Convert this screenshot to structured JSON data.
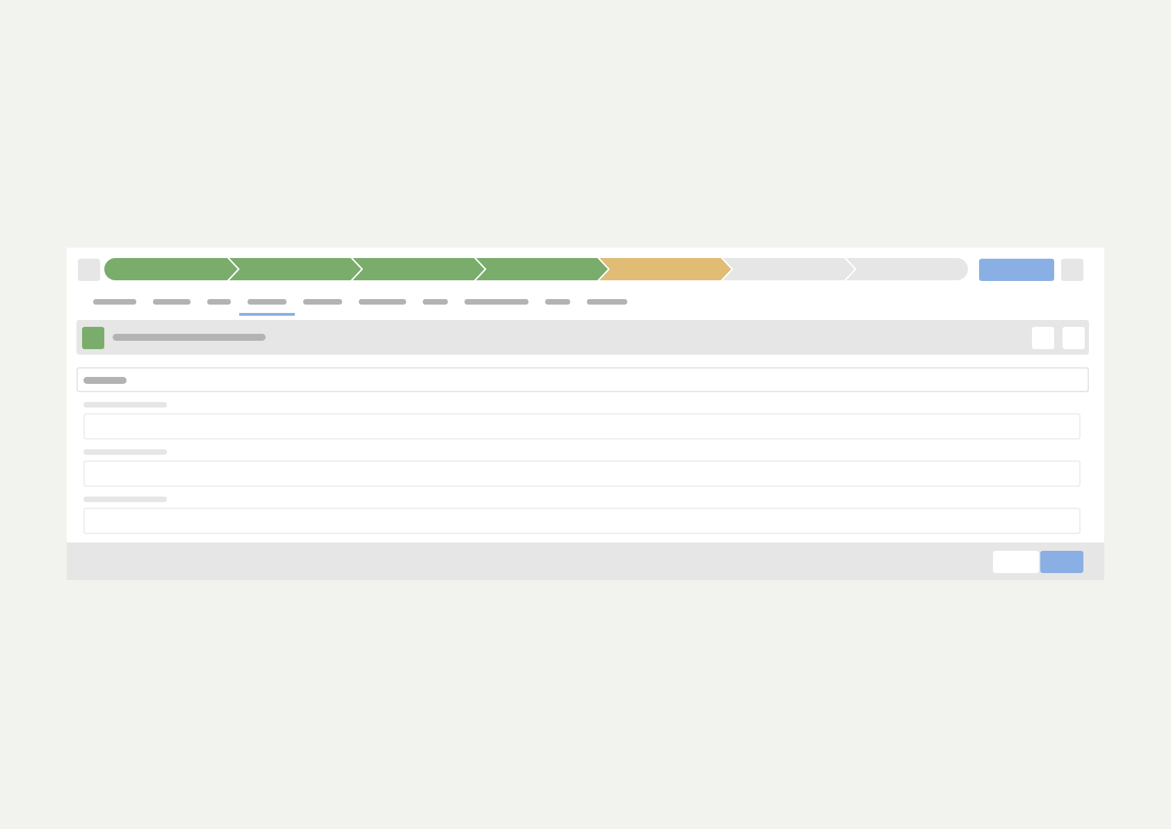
{
  "path": {
    "steps": [
      {
        "kind": "complete"
      },
      {
        "kind": "complete"
      },
      {
        "kind": "complete"
      },
      {
        "kind": "complete"
      },
      {
        "kind": "current"
      },
      {
        "kind": "pending"
      },
      {
        "kind": "pending"
      }
    ]
  },
  "tabs": [
    {
      "selected": false
    },
    {
      "selected": false
    },
    {
      "selected": false
    },
    {
      "selected": true
    },
    {
      "selected": false
    },
    {
      "selected": false
    },
    {
      "selected": false
    },
    {
      "selected": false
    },
    {
      "selected": false
    },
    {
      "selected": false
    }
  ],
  "fields": [
    {
      "kind": "input"
    },
    {
      "kind": "input"
    },
    {
      "kind": "input"
    }
  ]
}
